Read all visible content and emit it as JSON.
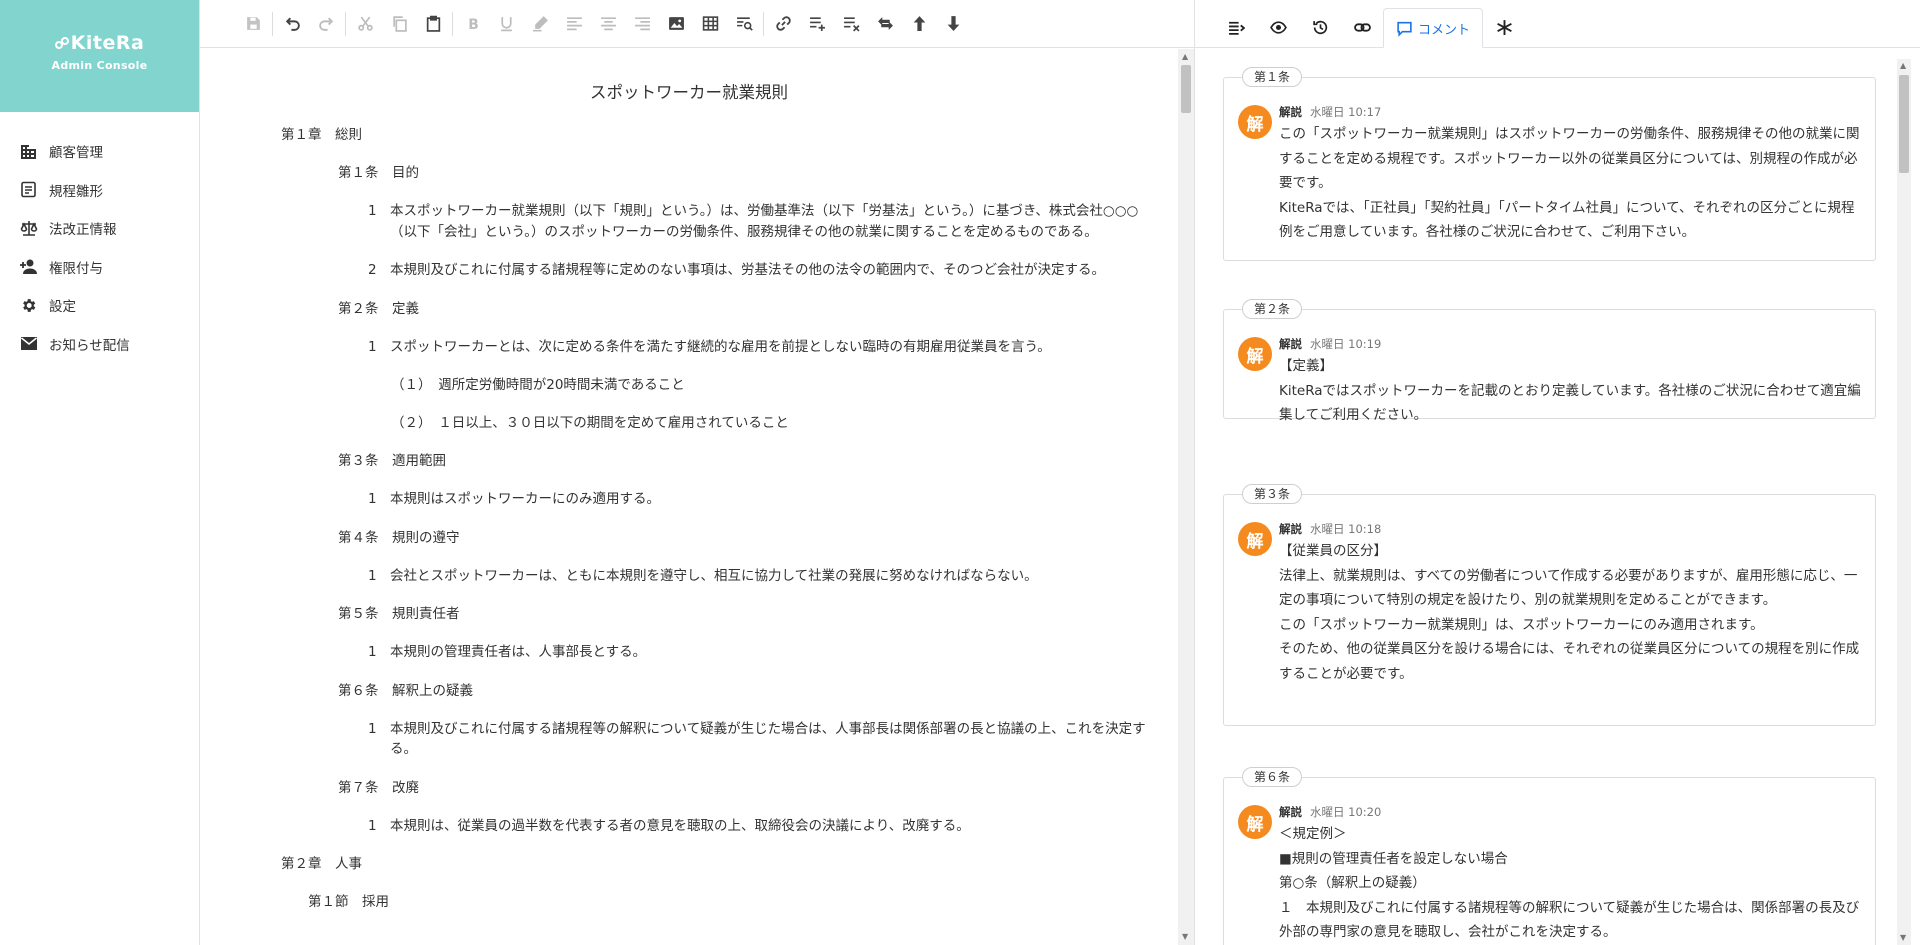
{
  "brand": {
    "name": "KiteRa",
    "subtitle": "Admin Console"
  },
  "nav": [
    {
      "label": "顧客管理",
      "icon": "building-icon"
    },
    {
      "label": "規程雛形",
      "icon": "document-list-icon"
    },
    {
      "label": "法改正情報",
      "icon": "scale-icon"
    },
    {
      "label": "権限付与",
      "icon": "add-user-icon"
    },
    {
      "label": "設定",
      "icon": "gear-icon"
    },
    {
      "label": "お知らせ配信",
      "icon": "mail-icon"
    }
  ],
  "document": {
    "title": "スポットワーカー就業規則",
    "chapter1": "第１章　総則",
    "a1": {
      "heading": "第１条　目的",
      "p1_num": "1",
      "p1": "本スポットワーカー就業規則（以下「規則」という。）は、労働基準法（以下「労基法」という。）に基づき、株式会社○○○（以下「会社」という。）のスポットワーカーの労働条件、服務規律その他の就業に関することを定めるものである。",
      "p2_num": "2",
      "p2": "本規則及びこれに付属する諸規程等に定めのない事項は、労基法その他の法令の範囲内で、そのつど会社が決定する。"
    },
    "a2": {
      "heading": "第２条　定義",
      "p1_num": "1",
      "p1": "スポットワーカーとは、次に定める条件を満たす継続的な雇用を前提としない臨時の有期雇用従業員を言う。",
      "i1": "（１）　週所定労働時間が20時間未満であること",
      "i2": "（２）　１日以上、３０日以下の期間を定めて雇用されていること"
    },
    "a3": {
      "heading": "第３条　適用範囲",
      "p1_num": "1",
      "p1": "本規則はスポットワーカーにのみ適用する。"
    },
    "a4": {
      "heading": "第４条　規則の遵守",
      "p1_num": "1",
      "p1": "会社とスポットワーカーは、ともに本規則を遵守し、相互に協力して社業の発展に努めなければならない。"
    },
    "a5": {
      "heading": "第５条　規則責任者",
      "p1_num": "1",
      "p1": "本規則の管理責任者は、人事部長とする。"
    },
    "a6": {
      "heading": "第６条　解釈上の疑義",
      "p1_num": "1",
      "p1": "本規則及びこれに付属する諸規程等の解釈について疑義が生じた場合は、人事部長は関係部署の長と協議の上、これを決定する。"
    },
    "a7": {
      "heading": "第７条　改廃",
      "p1_num": "1",
      "p1": "本規則は、従業員の過半数を代表する者の意見を聴取の上、取締役会の決議により、改廃する。"
    },
    "chapter2": "第２章　人事",
    "section1": "第１節　採用"
  },
  "panel": {
    "active_tab": "コメント",
    "comments": [
      {
        "label": "第１条",
        "avatar": "解",
        "author": "解説",
        "time": "水曜日 10:17",
        "lines": [
          "この「スポットワーカー就業規則」はスポットワーカーの労働条件、服務規律その他の就業に関することを定める規程です。スポットワーカー以外の従業員区分については、別規程の作成が必要です。",
          "KiteRaでは、「正社員」「契約社員」「パートタイム社員」について、それぞれの区分ごとに規程例をご用意しています。各社様のご状況に合わせて、ご利用下さい。"
        ]
      },
      {
        "label": "第２条",
        "avatar": "解",
        "author": "解説",
        "time": "水曜日 10:19",
        "lines": [
          "【定義】",
          "KiteRaではスポットワーカーを記載のとおり定義しています。各社様のご状況に合わせて適宜編集してご利用ください。"
        ]
      },
      {
        "label": "第３条",
        "avatar": "解",
        "author": "解説",
        "time": "水曜日 10:18",
        "lines": [
          "【従業員の区分】",
          "法律上、就業規則は、すべての労働者について作成する必要がありますが、雇用形態に応じ、一定の事項について特別の規定を設けたり、別の就業規則を定めることができます。",
          "この「スポットワーカー就業規則」は、スポットワーカーにのみ適用されます。",
          "そのため、他の従業員区分を設ける場合には、それぞれの従業員区分についての規程を別に作成することが必要です。"
        ]
      },
      {
        "label": "第６条",
        "avatar": "解",
        "author": "解説",
        "time": "水曜日 10:20",
        "lines": [
          "＜規定例＞",
          "■規則の管理責任者を設定しない場合",
          "第○条（解釈上の疑義）",
          "１　本規則及びこれに付属する諸規程等の解釈について疑義が生じた場合は、関係部署の長及び外部の専門家の意見を聴取し、会社がこれを決定する。"
        ]
      }
    ]
  },
  "colors": {
    "brand": "#82d4ce",
    "accent": "#1a73e8",
    "avatar": "#f58a1f"
  }
}
